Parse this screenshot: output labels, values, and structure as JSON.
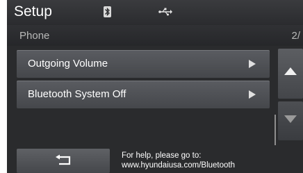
{
  "header": {
    "title": "Setup",
    "icons": [
      "bluetooth-icon",
      "usb-icon"
    ]
  },
  "breadcrumb": {
    "label": "Phone",
    "page": "2/"
  },
  "menu": {
    "items": [
      {
        "label": "Outgoing Volume"
      },
      {
        "label": "Bluetooth System Off"
      }
    ]
  },
  "footer": {
    "back_icon": "back-arrow-icon",
    "help_line1": "For help, please go to:",
    "help_line2": "www.hyundaiusa.com/Bluetooth"
  },
  "colors": {
    "background": "#2a2b2d",
    "item": "#505256",
    "text": "#ffffff"
  }
}
